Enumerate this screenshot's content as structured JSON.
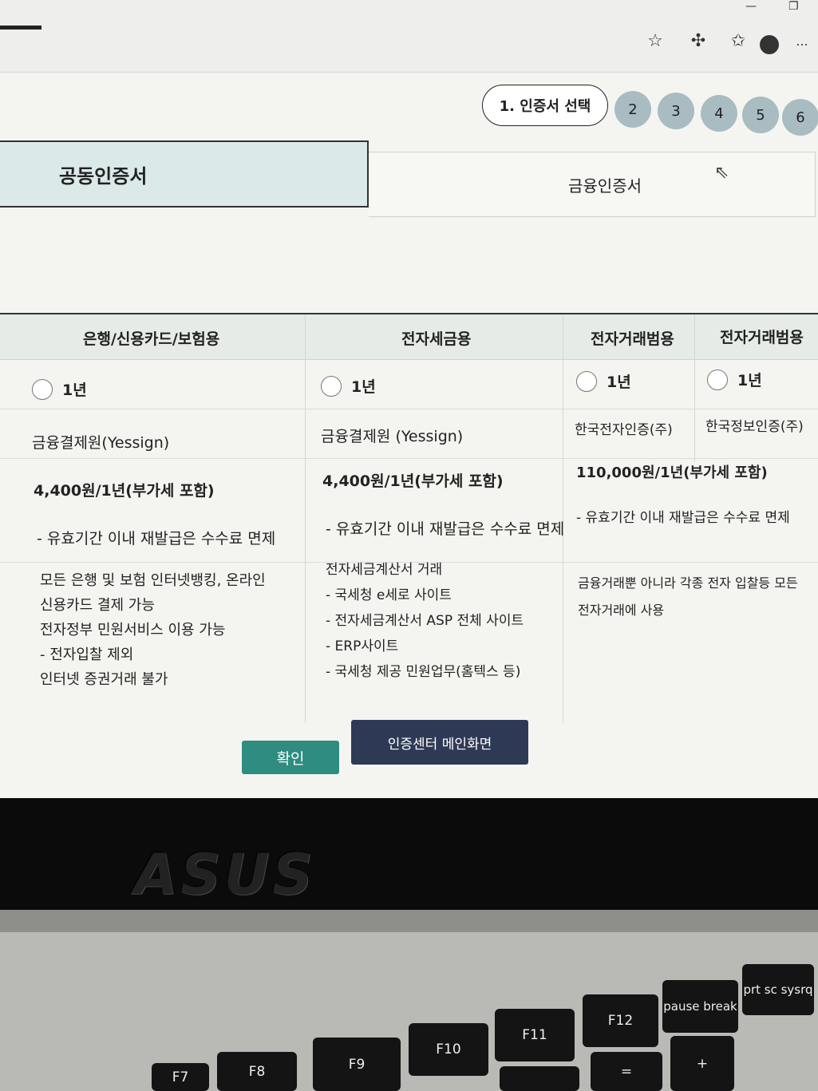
{
  "browser": {
    "icons": [
      "star-icon",
      "extensions-icon",
      "favorites-icon",
      "profile-icon",
      "more-icon"
    ],
    "more": "..."
  },
  "steps": {
    "current": "1. 인증서 선택",
    "others": [
      "2",
      "3",
      "4",
      "5",
      "6"
    ]
  },
  "tabs": {
    "active": "공동인증서",
    "inactive": "금융인증서"
  },
  "table": {
    "headers": [
      "은행/신용카드/보험용",
      "전자세금용",
      "전자거래범용",
      "전자거래범용"
    ],
    "period": [
      "1년",
      "1년",
      "1년",
      "1년"
    ],
    "issuers": [
      "금융결제원(Yessign)",
      "금융결제원 (Yessign)",
      "한국전자인증(주)",
      "한국정보인증(주)"
    ],
    "prices": [
      "4,400원/1년(부가세 포함)",
      "4,400원/1년(부가세 포함)",
      "110,000원/1년(부가세 포함)"
    ],
    "notes": [
      "- 유효기간 이내 재발급은 수수료 면제",
      "- 유효기간 이내 재발급은 수수료 면제",
      "- 유효기간 이내 재발급은 수수료 면제"
    ],
    "usage_col1": [
      "모든 은행 및 보험 인터넷뱅킹, 온라인",
      "신용카드 결제 가능",
      "전자정부 민원서비스 이용 가능",
      "- 전자입찰 제외",
      "인터넷 증권거래 불가"
    ],
    "usage_col2": [
      "전자세금계산서 거래",
      "- 국세청 e세로 사이트",
      "- 전자세금계산서 ASP 전체 사이트",
      "- ERP사이트",
      "- 국세청 제공 민원업무(홈텍스 등)"
    ],
    "usage_col3": [
      "금융거래뿐 아니라 각종 전자 입찰등 모든",
      "전자거래에 사용"
    ]
  },
  "buttons": {
    "confirm": "확인",
    "main": "인증센터 메인화면"
  },
  "laptop": {
    "logo": "ASUS",
    "keys": [
      "F7",
      "F8",
      "F9",
      "F10",
      "F11",
      "F12",
      "pause break",
      "prt sc sysrq",
      "+",
      "="
    ]
  }
}
